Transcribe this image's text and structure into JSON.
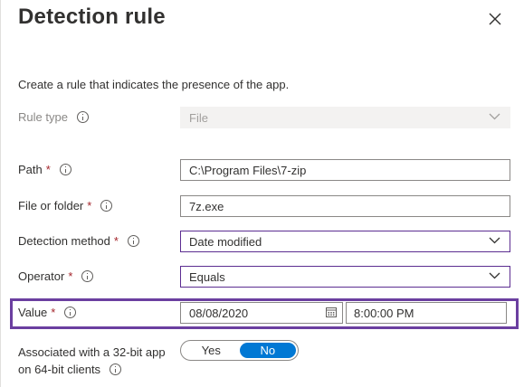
{
  "panel": {
    "title": "Detection rule",
    "description": "Create a rule that indicates the presence of the app."
  },
  "form": {
    "rule_type": {
      "label": "Rule type",
      "value": "File"
    },
    "path": {
      "label": "Path",
      "value": "C:\\Program Files\\7-zip"
    },
    "file_or_folder": {
      "label": "File or folder",
      "value": "7z.exe"
    },
    "detection_method": {
      "label": "Detection method",
      "value": "Date modified"
    },
    "operator": {
      "label": "Operator",
      "value": "Equals"
    },
    "value": {
      "label": "Value",
      "date": "08/08/2020",
      "time": "8:00:00 PM"
    },
    "associated": {
      "label_line1": "Associated with a 32-bit app",
      "label_line2": "on 64-bit clients",
      "yes_label": "Yes",
      "no_label": "No",
      "selected": "No"
    }
  },
  "required_marker": "*",
  "icons": {
    "close": "close-icon",
    "info": "info-icon",
    "chevron": "chevron-down-icon",
    "calendar": "calendar-icon"
  },
  "colors": {
    "highlight_border": "#6b3fa0",
    "toggle_active": "#0078d4",
    "required": "#a4262c",
    "dropdown_border": "#5c2d91"
  }
}
